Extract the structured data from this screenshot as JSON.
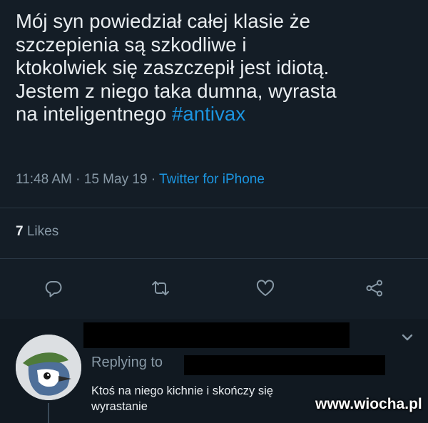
{
  "tweet": {
    "text_lines": [
      "Mój syn powiedział całej klasie że",
      "szczepienia są szkodliwe i",
      "ktokolwiek się zaszczepił jest idiotą.",
      "Jestem z niego taka dumna, wyrasta",
      "na inteligentnego"
    ],
    "hashtag": "#antivax",
    "time": "11:48 AM",
    "date": "15 May 19",
    "separator": "·",
    "source": "Twitter for iPhone",
    "likes_count": "7",
    "likes_label": "Likes"
  },
  "actions": {
    "icons": [
      "reply-icon",
      "retweet-icon",
      "like-icon",
      "share-icon"
    ]
  },
  "reply": {
    "replying_label": "Replying to",
    "text_line1": "Ktoś na niego kichnie i skończy się",
    "text_line2": "wyrastanie",
    "avatar_icon": "bird-avatar"
  },
  "watermark": "www.wiocha.pl",
  "colors": {
    "background": "#141d26",
    "reply_background": "#111921",
    "text": "#e9edf0",
    "secondary": "#8899a6",
    "accent": "#1b95e0",
    "divider": "#2a3744"
  }
}
